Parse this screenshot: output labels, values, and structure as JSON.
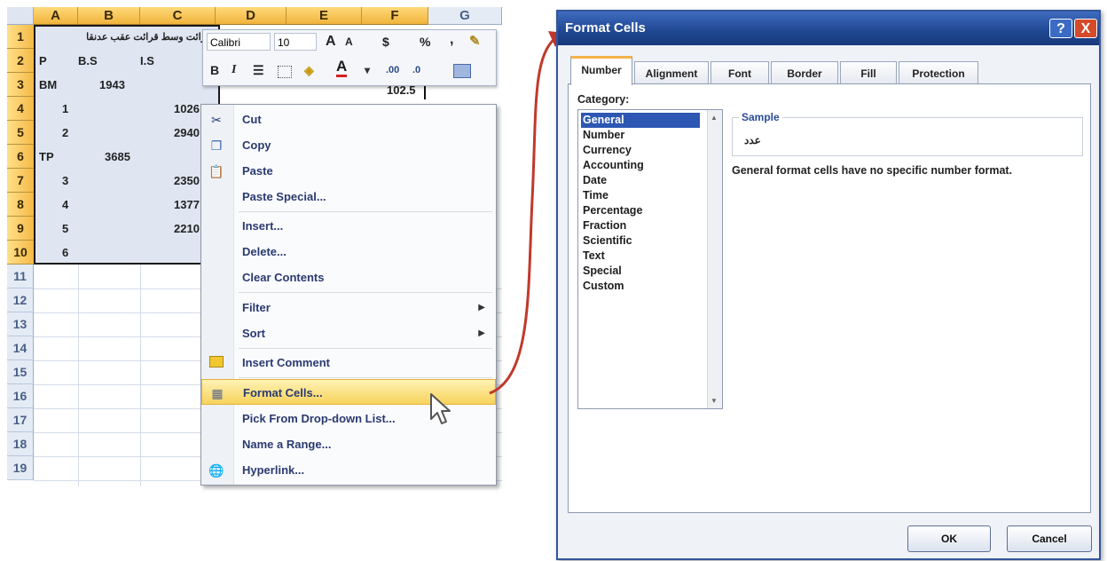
{
  "spreadsheet": {
    "columns": [
      "A",
      "B",
      "C",
      "D",
      "E",
      "F",
      "G"
    ],
    "rows": [
      "1",
      "2",
      "3",
      "4",
      "5",
      "6",
      "7",
      "8",
      "9",
      "10",
      "11",
      "12",
      "13",
      "14",
      "15",
      "16",
      "17",
      "18",
      "19"
    ],
    "cells": {
      "r1": "قرائت وسط قرائت عقب  عدنقا",
      "r2_a": "P",
      "r2_b": "B.S",
      "r2_c": "I.S",
      "r3_a": "BM",
      "r3_b": "1943",
      "r3_f": "102.5",
      "r4_a": "1",
      "r4_c": "1026",
      "r5_a": "2",
      "r5_c": "2940",
      "r6_a": "TP",
      "r6_b": "3685",
      "r7_a": "3",
      "r7_c": "2350",
      "r8_a": "4",
      "r8_c": "1377",
      "r9_a": "5",
      "r9_c": "2210",
      "r10_a": "6"
    }
  },
  "mini_toolbar": {
    "font": "Calibri",
    "size": "10",
    "grow": "A",
    "shrink": "A",
    "currency": "$",
    "percent": "%",
    "comma": ",",
    "bold": "B",
    "italic": "I",
    "font_color": "A"
  },
  "context_menu": {
    "items": [
      {
        "label": "Cut",
        "icon": "scissors-icon"
      },
      {
        "label": "Copy",
        "icon": "copy-icon"
      },
      {
        "label": "Paste",
        "icon": "paste-icon"
      },
      {
        "label": "Paste Special..."
      },
      {
        "label": "Insert..."
      },
      {
        "label": "Delete..."
      },
      {
        "label": "Clear Contents"
      },
      {
        "label": "Filter",
        "submenu": true
      },
      {
        "label": "Sort",
        "submenu": true
      },
      {
        "label": "Insert Comment",
        "icon": "comment-icon"
      },
      {
        "label": "Format Cells...",
        "icon": "format-cells-icon",
        "highlighted": true
      },
      {
        "label": "Pick From Drop-down List..."
      },
      {
        "label": "Name a Range..."
      },
      {
        "label": "Hyperlink...",
        "icon": "hyperlink-icon"
      }
    ]
  },
  "dialog": {
    "title": "Format Cells",
    "help": "?",
    "close": "X",
    "tabs": [
      "Number",
      "Alignment",
      "Font",
      "Border",
      "Fill",
      "Protection"
    ],
    "active_tab": "Number",
    "category_label": "Category:",
    "categories": [
      "General",
      "Number",
      "Currency",
      "Accounting",
      "Date",
      "Time",
      "Percentage",
      "Fraction",
      "Scientific",
      "Text",
      "Special",
      "Custom"
    ],
    "selected_category": "General",
    "sample_label": "Sample",
    "sample_value": "عدد",
    "description": "General format cells have no specific number format.",
    "ok": "OK",
    "cancel": "Cancel"
  },
  "colors": {
    "title_bar": "#1f4690",
    "selection": "#2d57b3",
    "highlight": "#f7d35c",
    "arrow": "#c0392b"
  }
}
